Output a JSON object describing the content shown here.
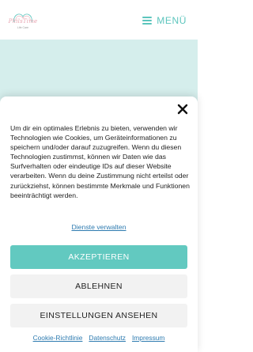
{
  "header": {
    "logo_text": "PhilsTime",
    "logo_sub": "Life Care",
    "menu_label": "MENÜ"
  },
  "cookie_banner": {
    "text": "Um dir ein optimales Erlebnis zu bieten, verwenden wir Technologien wie Cookies, um Geräteinformationen zu speichern und/oder darauf zuzugreifen. Wenn du diesen Technologien zustimmst, können wir Daten wie das Surfverhalten oder eindeutige IDs auf dieser Website verarbeiten. Wenn du deine Zustimmung nicht erteilst oder zurückziehst, können bestimmte Merkmale und Funktionen beeinträchtigt werden.",
    "manage_link": "Dienste verwalten",
    "accept_label": "AKZEPTIEREN",
    "deny_label": "ABLEHNEN",
    "preferences_label": "EINSTELLUNGEN ANSEHEN",
    "footer_links": {
      "cookie_policy": "Cookie-Richtlinie",
      "privacy": "Datenschutz",
      "imprint": "Impressum"
    }
  },
  "colors": {
    "accent": "#62c9c0",
    "hero_background": "#d5eeec",
    "link": "#2e7bb0",
    "secondary_button": "#f2f2f2"
  },
  "icons": {
    "menu": "hamburger-icon",
    "close": "close-icon",
    "logo": "heart-logo-icon"
  }
}
